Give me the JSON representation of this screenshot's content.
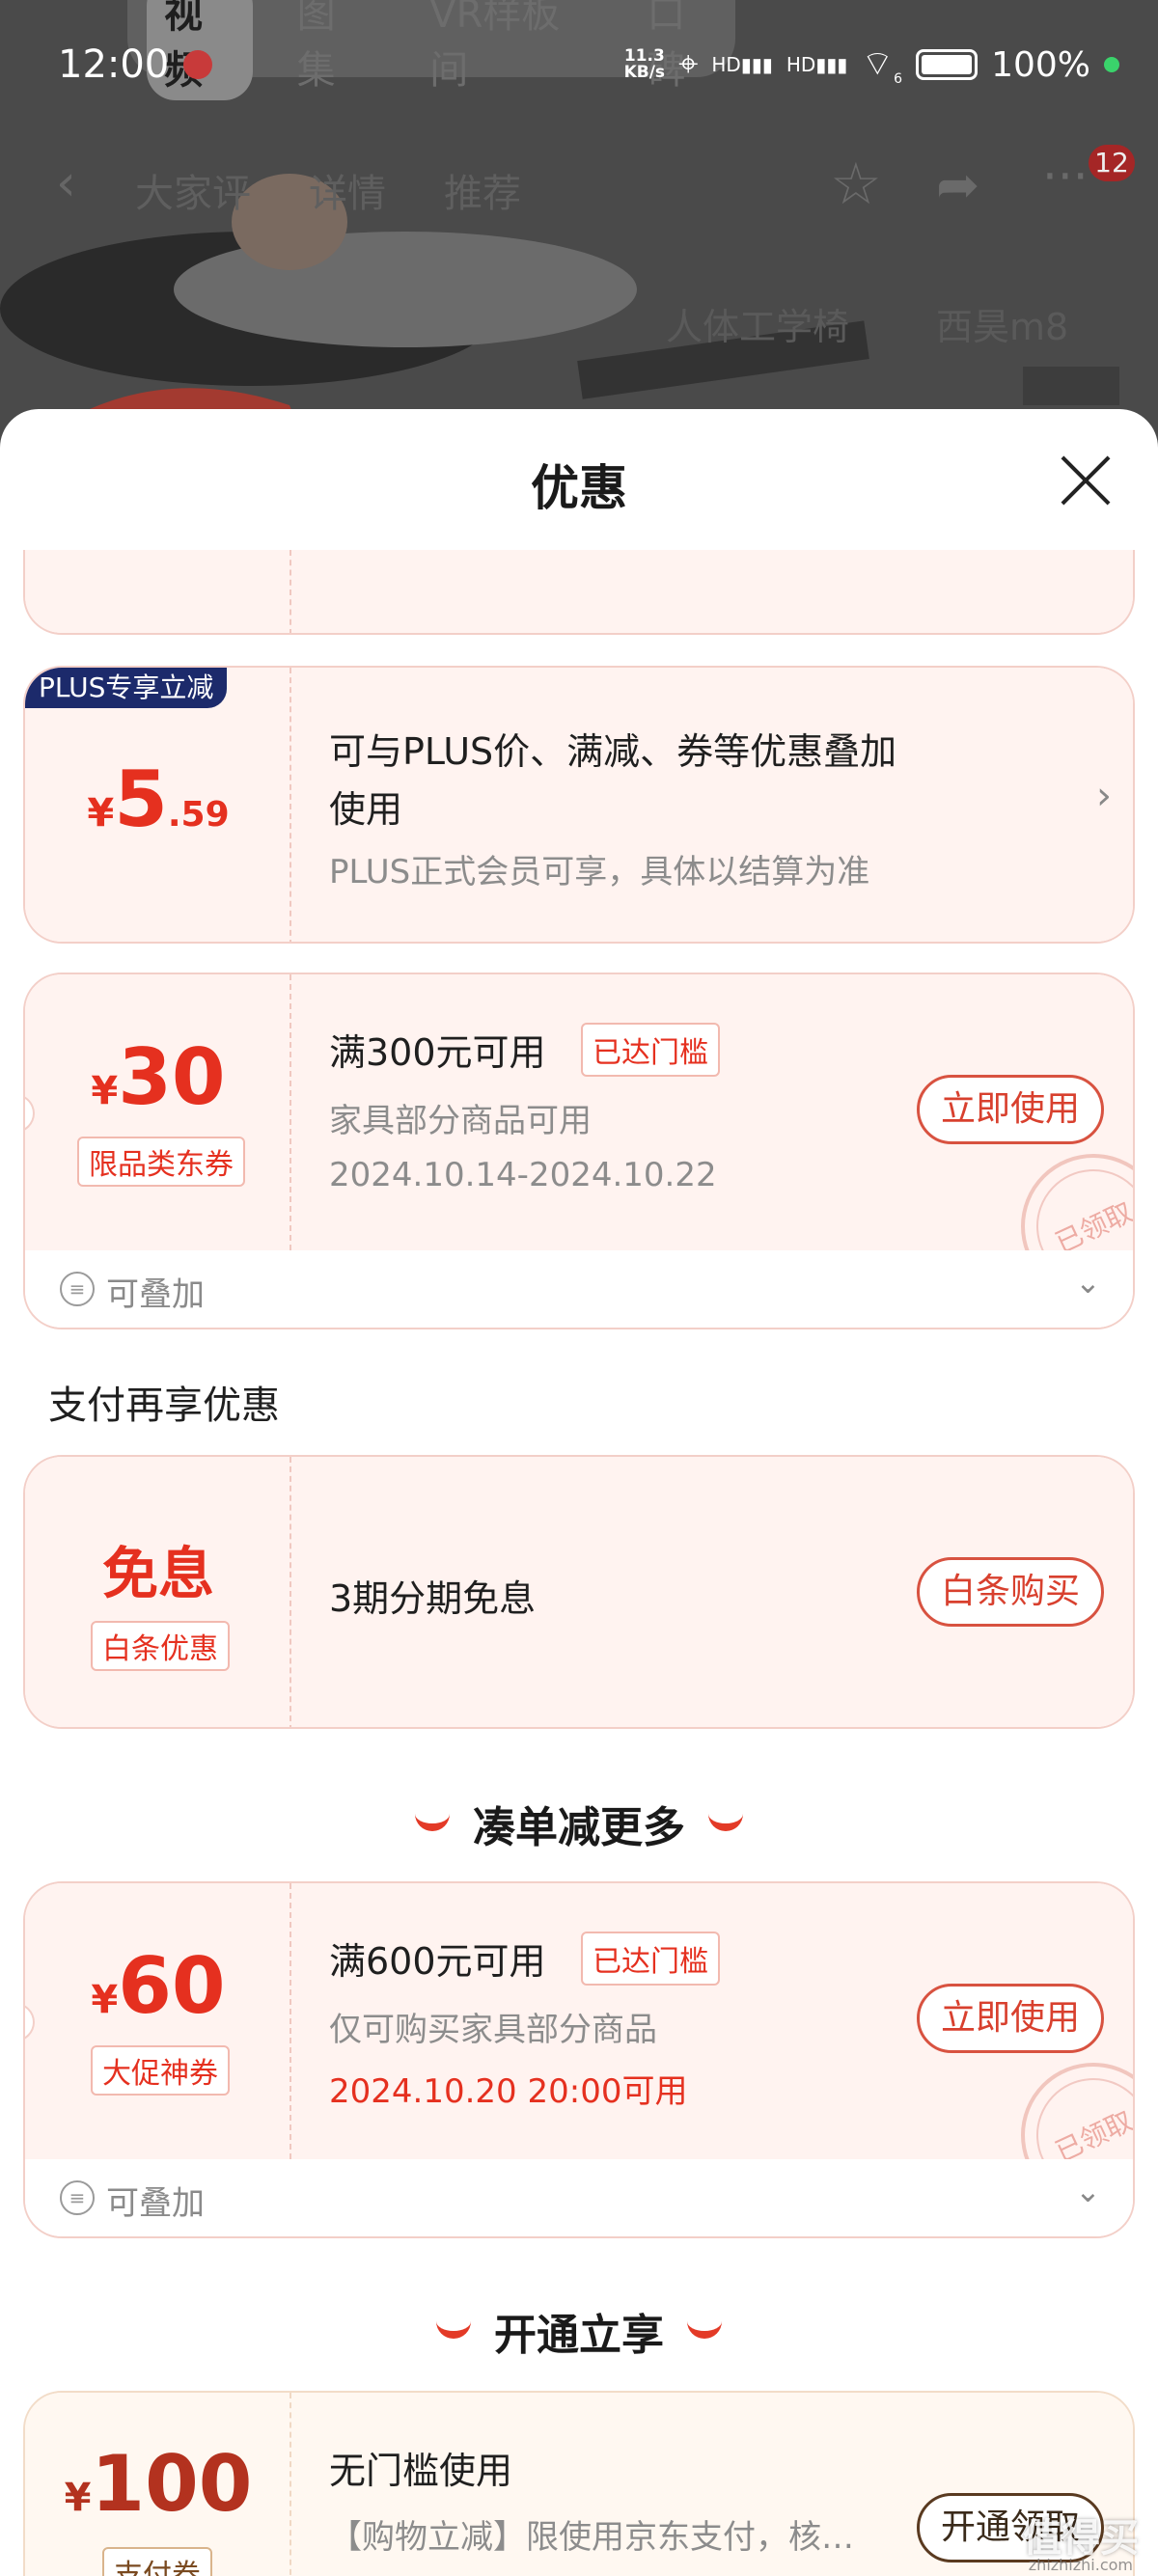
{
  "status_bar": {
    "time": "12:00",
    "net_speed_value": "11.3",
    "net_speed_unit": "KB/s",
    "hd1": "HD",
    "hd2": "HD",
    "wifi_sub": "6",
    "battery_pct": "100%"
  },
  "media_tabs": [
    "视频",
    "图集",
    "VR样板间",
    "口碑"
  ],
  "nav_tabs": [
    "大家评",
    "详情",
    "推荐"
  ],
  "nav_badge": "12",
  "bg_tags": [
    "人体工学椅",
    "西昊m8"
  ],
  "sheet": {
    "title": "优惠"
  },
  "cards": {
    "plus": {
      "badge": "PLUS专享立减",
      "currency": "¥",
      "amount_int": "5",
      "amount_dec": ".59",
      "title_line1": "可与PLUS价、满减、券等优惠叠加",
      "title_line2": "使用",
      "sub": "PLUS正式会员可享，具体以结算为准"
    },
    "coupon30": {
      "currency": "¥",
      "amount": "30",
      "tag": "限品类东券",
      "title": "满300元可用",
      "reached": "已达门槛",
      "sub": "家具部分商品可用",
      "date": "2024.10.14-2024.10.22",
      "button": "立即使用",
      "stamp": "已领取",
      "stack": "可叠加"
    },
    "baitiao": {
      "big": "免息",
      "tag": "白条优惠",
      "title": "3期分期免息",
      "button": "白条购买"
    },
    "coupon60": {
      "currency": "¥",
      "amount": "60",
      "tag": "大促神券",
      "title": "满600元可用",
      "reached": "已达门槛",
      "sub": "仅可购买家具部分商品",
      "date": "2024.10.20 20:00可用",
      "button": "立即使用",
      "stamp": "已领取",
      "stack": "可叠加"
    },
    "pay100": {
      "currency": "¥",
      "amount": "100",
      "tag": "支付券",
      "title": "无门槛使用",
      "sub": "【购物立减】限使用京东支付，核…",
      "button": "开通领取"
    }
  },
  "sections": {
    "pay_more": "支付再享优惠",
    "add_more": "凑单减更多",
    "open_enjoy": "开通立享"
  },
  "watermark": {
    "main": "值得买",
    "sub": "zhizhizhi.com"
  },
  "colors": {
    "accent": "#e5301f",
    "card_bg": "#fff3f0",
    "card_border": "#f3cfc8",
    "plus_badge": "#1c2a6b"
  }
}
